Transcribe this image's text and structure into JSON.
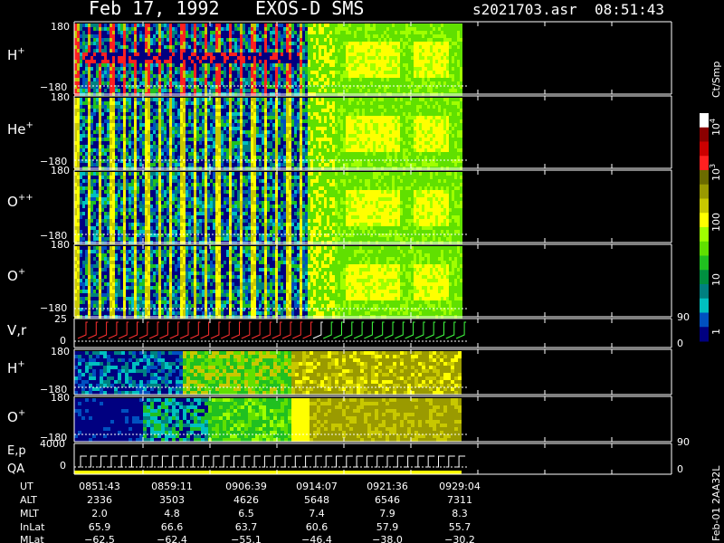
{
  "header": {
    "date": "Feb 17, 1992",
    "instrument": "EXOS-D SMS",
    "file": "s2021703.asr",
    "time": "08:51:43"
  },
  "colorbar": {
    "unit_label": "Ct/Smp",
    "tick_labels": [
      "10",
      "10",
      "100",
      "10",
      "1"
    ],
    "tick_exponents": [
      "4",
      "3",
      "",
      "",
      ""
    ],
    "colors": [
      "#ffffff",
      "#8b0000",
      "#cc0000",
      "#ff2020",
      "#6b6b00",
      "#9a9a00",
      "#c8c800",
      "#ffff00",
      "#a0ff00",
      "#60e000",
      "#20c020",
      "#009040",
      "#008080",
      "#00c0c0",
      "#0050c0",
      "#000080"
    ]
  },
  "panels": [
    {
      "name": "H",
      "charge": "+",
      "top": "180",
      "bottom": "−180"
    },
    {
      "name": "He",
      "charge": "+",
      "top": "180",
      "bottom": "−180"
    },
    {
      "name": "O",
      "charge": "++",
      "top": "180",
      "bottom": "−180"
    },
    {
      "name": "O",
      "charge": "+",
      "top": "180",
      "bottom": "−180"
    }
  ],
  "vr_panel": {
    "label": "V,r",
    "top": "25",
    "bottom": "0",
    "right_top": "90",
    "right_bottom": "0"
  },
  "lower_panels": [
    {
      "name": "H",
      "charge": "+",
      "top": "180",
      "bottom": "−180"
    },
    {
      "name": "O",
      "charge": "+",
      "top": "180",
      "bottom": "−180"
    }
  ],
  "ep_panel": {
    "label": "E,p",
    "label2": "QA",
    "top": "4000",
    "bottom": "0",
    "right_top": "90",
    "right_bottom": "0"
  },
  "ephemeris": {
    "row_labels": [
      "UT",
      "ALT",
      "MLT",
      "InLat",
      "MLat"
    ],
    "columns": [
      [
        "0851:43",
        "2336",
        "2.0",
        "65.9",
        "−62.5"
      ],
      [
        "0859:11",
        "3503",
        "4.8",
        "66.6",
        "−62.4"
      ],
      [
        "0906:39",
        "4626",
        "6.5",
        "63.7",
        "−55.1"
      ],
      [
        "0914:07",
        "5648",
        "7.4",
        "60.6",
        "−46.4"
      ],
      [
        "0921:36",
        "6546",
        "7.9",
        "57.9",
        "−38.0"
      ],
      [
        "0929:04",
        "7311",
        "8.3",
        "55.7",
        "−30.2"
      ]
    ]
  },
  "footer_id": "Feb-01 2AA32L",
  "chart_data": {
    "type": "heatmap",
    "title": "Feb 17, 1992   EXOS-D SMS",
    "x_tick_labels": [
      "0851:43",
      "0859:11",
      "0906:39",
      "0914:07",
      "0921:36",
      "0929:04"
    ],
    "y_range_deg": [
      -180,
      180
    ],
    "series": [
      {
        "name": "H+"
      },
      {
        "name": "He+"
      },
      {
        "name": "O++"
      },
      {
        "name": "O+"
      },
      {
        "name": "V,r"
      },
      {
        "name": "H+"
      },
      {
        "name": "O+"
      },
      {
        "name": "E,p"
      }
    ],
    "colorbar_range": [
      1,
      10000
    ],
    "colorbar_scale": "log"
  }
}
